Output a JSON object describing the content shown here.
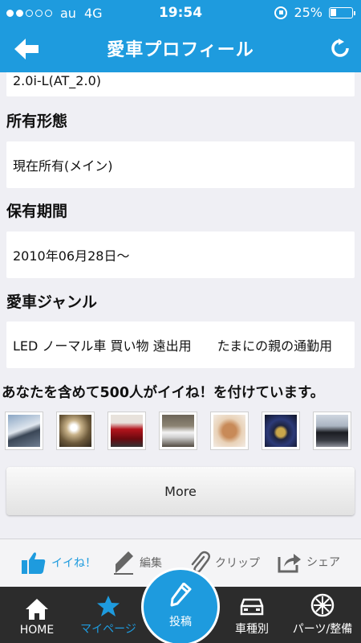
{
  "status_bar": {
    "carrier": "au",
    "network": "4G",
    "time": "19:54",
    "battery": "25%",
    "battery_level": 0.25,
    "signal_dots_filled": 2,
    "signal_dots_total": 5
  },
  "header": {
    "title": "愛車プロフィール",
    "back_icon": "back-arrow-icon",
    "refresh_icon": "refresh-icon",
    "accent_color": "#1e9bde"
  },
  "profile": {
    "grade_value_partial": "2.0i-L(AT_2.0)",
    "ownership_label": "所有形態",
    "ownership_value": "現在所有(メイン)",
    "period_label": "保有期間",
    "period_value": "2010年06月28日〜",
    "genre_label": "愛車ジャンル",
    "genre_value": "LED ノーマル車 買い物 遠出用　　たまにの親の通勤用"
  },
  "likes": {
    "text": "あなたを含めて500人がイイね！を付けています。",
    "thumbnails": [
      {
        "name": "thumb-white-car"
      },
      {
        "name": "thumb-headlight"
      },
      {
        "name": "thumb-red-car"
      },
      {
        "name": "thumb-white-sedan"
      },
      {
        "name": "thumb-dog"
      },
      {
        "name": "thumb-wheel"
      },
      {
        "name": "thumb-dark-car"
      }
    ],
    "more_label": "More"
  },
  "actions": {
    "like": "イイね！",
    "edit": "編集",
    "clip": "クリップ",
    "share": "シェア"
  },
  "tabs": {
    "home": "HOME",
    "mypage": "マイページ",
    "post": "投稿",
    "by_model": "車種別",
    "parts": "パーツ/整備"
  }
}
